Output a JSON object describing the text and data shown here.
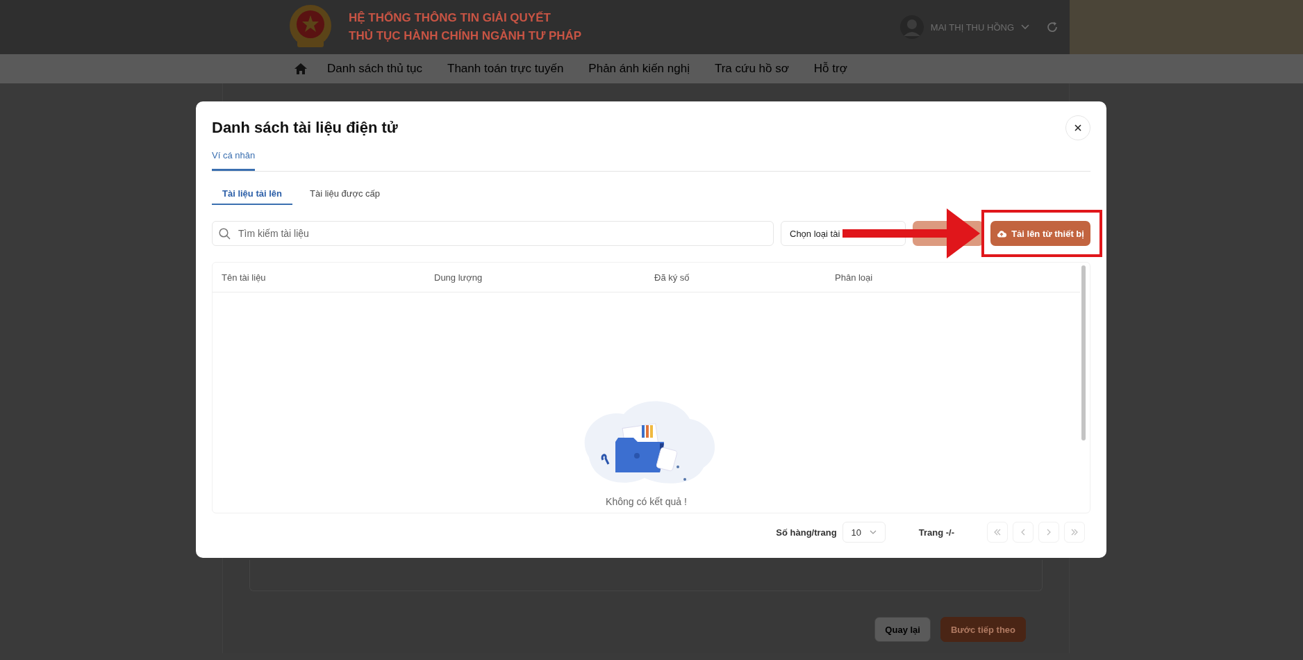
{
  "header": {
    "title_lines": [
      "HỆ THỐNG THÔNG TIN GIẢI QUYẾT",
      "THỦ TỤC HÀNH CHÍNH NGÀNH TƯ PHÁP"
    ],
    "user_name": "MAI THỊ THU HỒNG"
  },
  "nav": {
    "items": [
      "Danh sách thủ tục",
      "Thanh toán trực tuyến",
      "Phản ánh kiến nghị",
      "Tra cứu hồ sơ",
      "Hỗ trợ"
    ]
  },
  "page_buttons": [
    {
      "label": "Quay lại",
      "kind": "secondary"
    },
    {
      "label": "Bước tiếp theo",
      "kind": "primary"
    }
  ],
  "modal": {
    "title": "Danh sách tài liệu điện tử",
    "tabs": [
      {
        "label": "Ví cá nhân",
        "selected": true
      }
    ],
    "sub_tabs": [
      {
        "label": "Tài liệu tải lên",
        "selected": true
      },
      {
        "label": "Tài liệu được cấp",
        "selected": false
      }
    ],
    "search": {
      "placeholder": "Tìm kiếm tài liệu"
    },
    "type_select": {
      "placeholder": "Chọn loại tài"
    },
    "filter_button": {
      "disabled": true
    },
    "upload_button": {
      "label": "Tải lên từ thiết bị"
    },
    "table": {
      "columns": [
        "Tên tài liệu",
        "Dung lượng",
        "Đã ký số",
        "Phân loại"
      ],
      "empty_text": "Không có kết quả !"
    },
    "pagination": {
      "rows_label": "Số hàng/trang",
      "rows_value": "10",
      "page_label": "Trang -/-"
    }
  },
  "annotation": {
    "arrow": true,
    "highlight_box": true
  }
}
